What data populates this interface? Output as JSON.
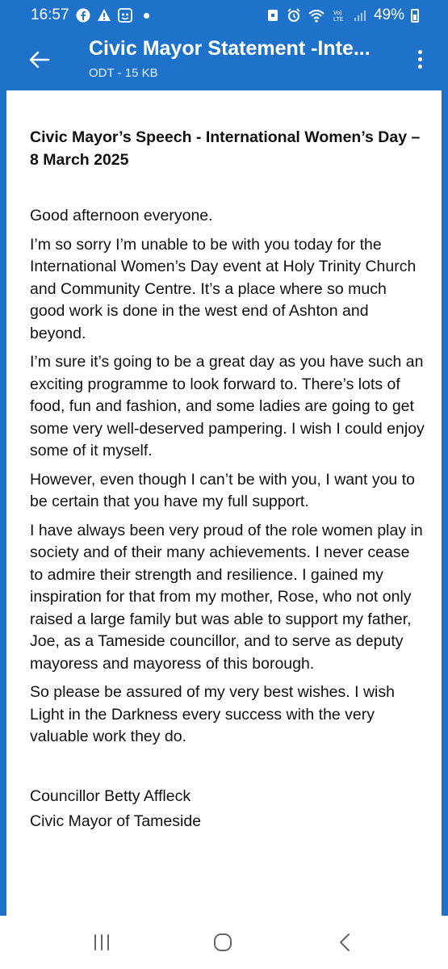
{
  "status": {
    "time": "16:57",
    "battery": "49%"
  },
  "header": {
    "title": "Civic Mayor Statement -Inte...",
    "subtitle": "ODT - 15 KB",
    "icons": {
      "back": "arrow-left-icon",
      "more": "more-vert-icon"
    },
    "color": "#1f72c9"
  },
  "document": {
    "heading": "Civic Mayor’s Speech - International Women’s Day – 8 March 2025",
    "paragraphs": [
      "Good afternoon everyone.",
      "I’m so sorry I’m unable to be with you today for the International Women’s Day event at Holy Trinity Church and Community Centre. It’s a place where so much good work is done in the west end of Ashton and beyond.",
      "I’m sure it’s going to be a great day as you have such an exciting programme to look forward to. There’s lots of food, fun and fashion, and some ladies are going to get some very well-deserved pampering. I wish I could enjoy some of it myself.",
      "However, even though I can’t be with you, I want you to be certain that you have my full support.",
      "I have always been very proud of the role women play in society and of their many achievements. I never cease to admire their strength and resilience. I gained my inspiration for that from my mother, Rose, who not only raised a large family but was able to support my father, Joe, as a Tameside councillor, and to serve as deputy mayoress and mayoress of this borough.",
      "So please be assured of my very best wishes. I wish Light in the Darkness every success with the very valuable work they do."
    ],
    "signature": {
      "name": "Councillor Betty Affleck",
      "role": "Civic Mayor of Tameside"
    }
  },
  "nav": {
    "icons": [
      "recent-apps-icon",
      "home-icon",
      "back-icon"
    ]
  }
}
